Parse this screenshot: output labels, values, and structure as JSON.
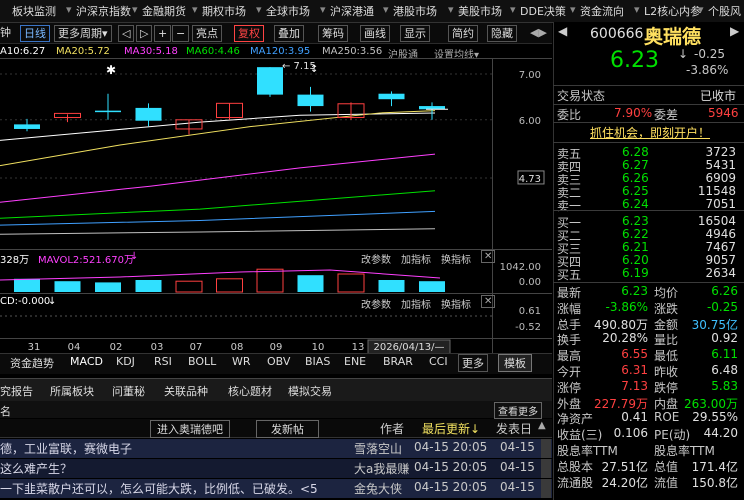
{
  "menu": [
    "板块监测",
    "沪深京指数",
    "金融期货",
    "期权市场",
    "全球市场",
    "沪深港通",
    "港股市场",
    "美股市场",
    "DDE决策",
    "资金流向",
    "L2核心内参",
    "个股风"
  ],
  "toolbar": {
    "left_cut": "钟",
    "period": "日线",
    "more_period": "更多周期",
    "nav": [
      "◁",
      "▷",
      "+",
      "−"
    ],
    "highlight": "亮点",
    "adjust": "复权",
    "overlay": "叠加",
    "chip": "筹码",
    "draw_line": "画线",
    "display": "显示",
    "simple": "简约",
    "hide": "隐藏"
  },
  "ma_line": {
    "ma10": "A10:6.27",
    "ma20": "MA20:5.72",
    "ma30": "MA30:5.18",
    "ma60": "MA60:4.46",
    "ma120": "MA120:3.95",
    "ma250": "MA250:3.56",
    "index": "沪股通",
    "setting": "设置均线"
  },
  "chart_data": {
    "type": "candlestick",
    "x_ticks": [
      "31",
      "04",
      "02",
      "03",
      "07",
      "08",
      "09",
      "10",
      "13"
    ],
    "x_cursor_label": "2026/04/13/—",
    "y_ticks": [
      7.0,
      6.0,
      4.73
    ],
    "ylim": [
      3.2,
      7.35
    ],
    "highlight_price": "4.73",
    "annotation_high": "7.15",
    "candles": [
      {
        "o": 5.9,
        "h": 6.02,
        "l": 5.75,
        "c": 5.8,
        "color": "cyan"
      },
      {
        "o": 6.05,
        "h": 6.12,
        "l": 5.95,
        "c": 6.14,
        "color": "red"
      },
      {
        "o": 6.2,
        "h": 6.57,
        "l": 6.0,
        "c": 6.2,
        "color": "cyan"
      },
      {
        "o": 6.26,
        "h": 6.36,
        "l": 5.86,
        "c": 5.98,
        "color": "cyan"
      },
      {
        "o": 5.8,
        "h": 6.0,
        "l": 5.68,
        "c": 6.0,
        "color": "red"
      },
      {
        "o": 6.05,
        "h": 6.36,
        "l": 6.0,
        "c": 6.36,
        "color": "red"
      },
      {
        "o": 7.15,
        "h": 7.15,
        "l": 6.5,
        "c": 6.55,
        "color": "cyan"
      },
      {
        "o": 6.55,
        "h": 6.72,
        "l": 6.18,
        "c": 6.3,
        "color": "cyan"
      },
      {
        "o": 6.05,
        "h": 6.38,
        "l": 6.0,
        "c": 6.35,
        "color": "red"
      },
      {
        "o": 6.57,
        "h": 6.62,
        "l": 6.3,
        "c": 6.45,
        "color": "cyan"
      },
      {
        "o": 6.3,
        "h": 6.38,
        "l": 6.0,
        "c": 6.23,
        "color": "cyan"
      }
    ],
    "volume_title_left": "328万",
    "volume_mavol2": "MAVOL2:521.670万",
    "volume_y_ticks": [
      "1042.00",
      "0.00"
    ],
    "volumes": [
      0.55,
      0.45,
      0.4,
      0.5,
      0.45,
      0.55,
      0.95,
      0.7,
      0.75,
      0.5,
      0.45
    ],
    "volume_colors": [
      "cyan",
      "cyan",
      "cyan",
      "cyan",
      "red",
      "red",
      "red",
      "cyan",
      "red",
      "cyan",
      "cyan"
    ],
    "macd_title": "CD:-0.000",
    "macd_y_ticks": [
      "0.61",
      "-0.52"
    ]
  },
  "sub_controls": [
    "改参数",
    "加指标",
    "换指标"
  ],
  "bottom_tabs": [
    "资金趋势",
    "MACD",
    "KDJ",
    "RSI",
    "BOLL",
    "WR",
    "OBV",
    "BIAS",
    "ENE",
    "BRAR",
    "CCI",
    "更多",
    "模板"
  ],
  "news_tabs": [
    "究报告",
    "所属板块",
    "问董秘",
    "关联品种",
    "核心题材",
    "模拟交易"
  ],
  "news_header": {
    "left": "名",
    "more": "查看更多"
  },
  "news_toolbar": {
    "enter": "进入奥瑞德吧",
    "post": "发新帖",
    "author": "作者",
    "latest": "最后更新",
    "post_time": "发表日"
  },
  "news_rows": [
    {
      "title": "德，工业富联，赛微电子",
      "author": "雪落空山",
      "time": "04-15 20:05",
      "date": "04-15"
    },
    {
      "title": "这么难产生？",
      "author": "大a我最赚",
      "time": "04-15 20:05",
      "date": "04-15"
    },
    {
      "title": "一下韭菜散户还可以，怎么可能大跌，比例低、已破发。<5",
      "author": "金兔大侠",
      "time": "04-15 20:05",
      "date": "04-15"
    }
  ],
  "quote": {
    "code": "600666",
    "name": "奥瑞德",
    "price": "6.23",
    "change": "-0.25",
    "pct": "-3.86%",
    "state_label": "交易状态",
    "state": "已收市",
    "weibi_label": "委比",
    "weibi": "7.90%",
    "weicha_label": "委差",
    "weicha": "5946",
    "promo": "抓住机会，即刻开户！",
    "asks": [
      {
        "l": "卖五",
        "p": "6.28",
        "v": "3723"
      },
      {
        "l": "卖四",
        "p": "6.27",
        "v": "5431"
      },
      {
        "l": "卖三",
        "p": "6.26",
        "v": "6909"
      },
      {
        "l": "卖二",
        "p": "6.25",
        "v": "11548"
      },
      {
        "l": "卖一",
        "p": "6.24",
        "v": "7051"
      }
    ],
    "bids": [
      {
        "l": "买一",
        "p": "6.23",
        "v": "16504"
      },
      {
        "l": "买二",
        "p": "6.22",
        "v": "4946"
      },
      {
        "l": "买三",
        "p": "6.21",
        "v": "7467"
      },
      {
        "l": "买四",
        "p": "6.20",
        "v": "9057"
      },
      {
        "l": "买五",
        "p": "6.19",
        "v": "2634"
      }
    ],
    "stats": [
      {
        "l1": "最新",
        "v1": "6.23",
        "c1": "g",
        "l2": "均价",
        "v2": "6.26",
        "c2": "g"
      },
      {
        "l1": "涨幅",
        "v1": "-3.86%",
        "c1": "g",
        "l2": "涨跌",
        "v2": "-0.25",
        "c2": "g"
      },
      {
        "l1": "总手",
        "v1": "490.80万",
        "c1": "w",
        "l2": "金额",
        "v2": "30.75亿",
        "c2": "c"
      },
      {
        "l1": "换手",
        "v1": "20.28%",
        "c1": "w",
        "l2": "量比",
        "v2": "0.92",
        "c2": "w"
      },
      {
        "l1": "最高",
        "v1": "6.55",
        "c1": "r",
        "l2": "最低",
        "v2": "6.11",
        "c2": "g"
      },
      {
        "l1": "今开",
        "v1": "6.31",
        "c1": "r",
        "l2": "昨收",
        "v2": "6.48",
        "c2": "w"
      },
      {
        "l1": "涨停",
        "v1": "7.13",
        "c1": "r",
        "l2": "跌停",
        "v2": "5.83",
        "c2": "g"
      },
      {
        "l1": "外盘",
        "v1": "227.79万",
        "c1": "r",
        "l2": "内盘",
        "v2": "263.00万",
        "c2": "g"
      },
      {
        "l1": "净资产",
        "v1": "0.41",
        "c1": "w",
        "l2": "ROE",
        "v2": "29.55%",
        "c2": "w"
      },
      {
        "l1": "收益(三)",
        "v1": "0.106",
        "c1": "w",
        "l2": "PE(动)",
        "v2": "44.20",
        "c2": "w"
      },
      {
        "l1": "股息率TTM",
        "v1": "",
        "c1": "w",
        "l2": "股息率TTM",
        "v2": "",
        "c2": "w"
      },
      {
        "l1": "总股本",
        "v1": "27.51亿",
        "c1": "w",
        "l2": "总值",
        "v2": "171.4亿",
        "c2": "w"
      },
      {
        "l1": "流通股",
        "v1": "24.20亿",
        "c1": "w",
        "l2": "流值",
        "v2": "150.8亿",
        "c2": "w"
      }
    ]
  },
  "colors": {
    "up": "#ff4040",
    "down": "#00e000",
    "cyan": "#30e0ff",
    "bg": "#000000"
  }
}
